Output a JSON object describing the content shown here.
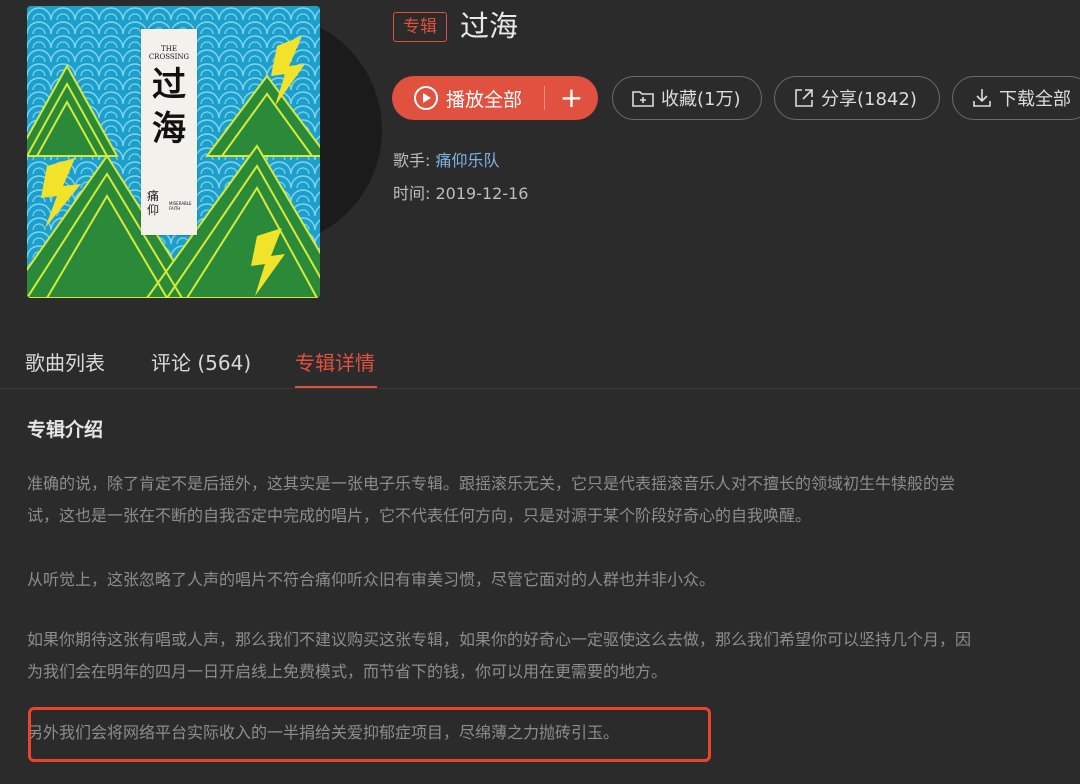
{
  "album": {
    "tag": "专辑",
    "title": "过海",
    "cover": {
      "english_title": "THE CROSSING",
      "chinese_title": "过海",
      "band_text": "MISERABLE FAITH",
      "seal_text": "痛仰"
    }
  },
  "actions": {
    "play_all": "播放全部",
    "add_icon": "plus-icon",
    "collect": "收藏(1万)",
    "share": "分享(1842)",
    "download": "下载全部"
  },
  "meta": {
    "artist_label": "歌手:",
    "artist": "痛仰乐队",
    "date_label": "时间:",
    "date": "2019-12-16"
  },
  "tabs": [
    {
      "label": "歌曲列表"
    },
    {
      "label": "评论 (564)"
    },
    {
      "label": "专辑详情",
      "active": true
    }
  ],
  "description": {
    "heading": "专辑介绍",
    "lines": [
      "准确的说，除了肯定不是后摇外，这其实是一张电子乐专辑。跟摇滚乐无关，它只是代表摇滚音乐人对不擅长的领域初生牛犊般的尝",
      "试，这也是一张在不断的自我否定中完成的唱片，它不代表任何方向，只是对源于某个阶段好奇心的自我唤醒。",
      "从听觉上，这张忽略了人声的唱片不符合痛仰听众旧有审美习惯，尽管它面对的人群也并非小众。",
      "如果你期待这张有唱或人声，那么我们不建议购买这张专辑，如果你的好奇心一定驱使这么去做，那么我们希望你可以坚持几个月，因",
      "为我们会在明年的四月一日开启线上免费模式，而节省下的钱，你可以用在更需要的地方。",
      "另外我们会将网络平台实际收入的一半捐给关爱抑郁症项目，尽绵薄之力抛砖引玉。"
    ]
  },
  "colors": {
    "accent": "#e0513f",
    "highlight_box": "#e8452c",
    "link": "#7fb2e8"
  }
}
